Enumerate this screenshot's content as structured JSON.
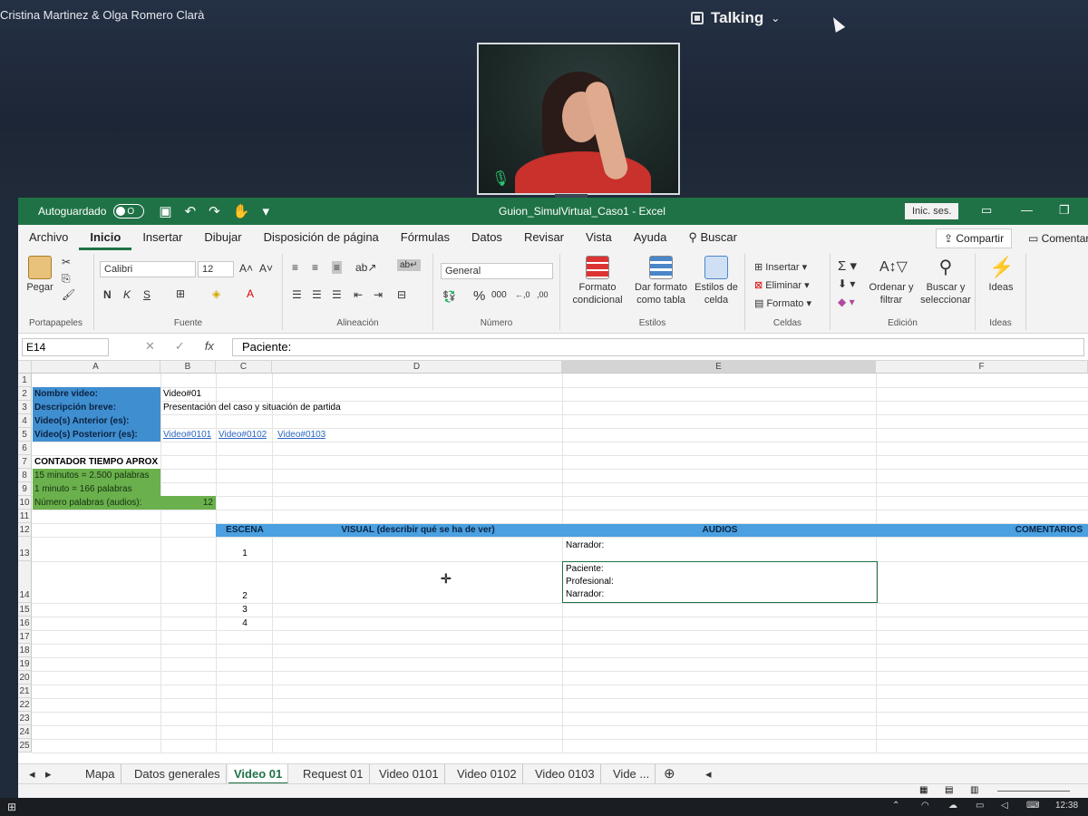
{
  "call": {
    "participants": "Cristina Martinez & Olga Romero Clarà",
    "status": "Talking"
  },
  "excel": {
    "autosave_label": "Autoguardado",
    "autosave_state": "O",
    "file_title": "Guion_SimulVirtual_Caso1  -  Excel",
    "signin_label": "Inic. ses.",
    "menu": [
      "Archivo",
      "Inicio",
      "Insertar",
      "Dibujar",
      "Disposición de página",
      "Fórmulas",
      "Datos",
      "Revisar",
      "Vista",
      "Ayuda"
    ],
    "search_label": "Buscar",
    "share_label": "Compartir",
    "comment_label": "Comentar",
    "ribbon": {
      "paste": "Pegar",
      "clipboard": "Portapapeles",
      "font_name": "Calibri",
      "font_size": "12",
      "font_group": "Fuente",
      "align_group": "Alineación",
      "number_format": "General",
      "number_group": "Número",
      "cond_format": "Formato condicional",
      "table_format": "Dar formato como tabla",
      "cell_styles": "Estilos de celda",
      "styles_group": "Estilos",
      "insert": "Insertar",
      "delete": "Eliminar",
      "format": "Formato",
      "cells_group": "Celdas",
      "sort_filter": "Ordenar y filtrar",
      "find_select": "Buscar y seleccionar",
      "edit_group": "Edición",
      "ideas": "Ideas",
      "ideas_group": "Ideas"
    },
    "namebox": "E14",
    "formula": "Paciente:",
    "columns": [
      "A",
      "B",
      "C",
      "D",
      "E",
      "F"
    ],
    "rows": [
      "1",
      "2",
      "3",
      "4",
      "5",
      "6",
      "7",
      "8",
      "9",
      "10",
      "11",
      "12",
      "13",
      "14",
      "15",
      "16",
      "17",
      "18",
      "19",
      "20",
      "21",
      "22",
      "23",
      "24",
      "25"
    ],
    "cells": {
      "a2": "Nombre video:",
      "b2": "Video#01",
      "a3": "Descripción breve:",
      "b3": "Presentación del caso y situación de partida",
      "a4": "Video(s) Anterior (es):",
      "a5": "Video(s) Posteriorr (es):",
      "b5": "Video#0101",
      "c5": "Video#0102",
      "d5": "Video#0103",
      "a7": "CONTADOR TIEMPO APROX",
      "a8": "15 minutos = 2.500 palabras",
      "a9": "1 minuto = 166 palabras",
      "a10": "Número palabras (audios):",
      "b10": "12",
      "h_escena": "ESCENA",
      "h_visual": "VISUAL (describir qué se ha de ver)",
      "h_audios": "AUDIOS",
      "h_comentarios": "COMENTARIOS",
      "c13": "1",
      "e13": "Narrador:",
      "e14a": "Paciente:",
      "e14b": "Profesional:",
      "e14c": "Narrador:",
      "c14": "2",
      "c15": "3",
      "c16": "4"
    },
    "sheets": [
      "Mapa",
      "Datos generales",
      "Video 01",
      "Request 01",
      "Video 0101",
      "Video 0102",
      "Video 0103",
      "Vide ..."
    ],
    "active_sheet": "Video 01"
  },
  "taskbar": {
    "clock": "12:38"
  }
}
